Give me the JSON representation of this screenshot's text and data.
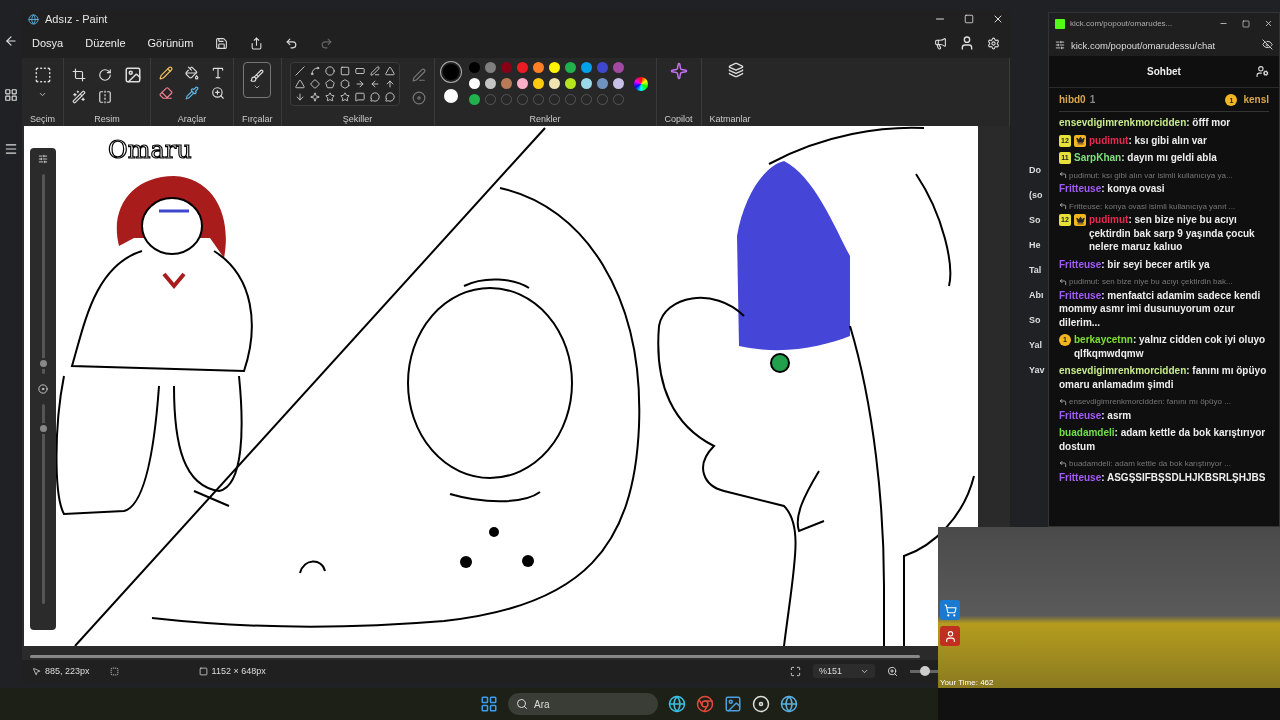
{
  "paint": {
    "title": "Adsız - Paint",
    "menu": [
      "Dosya",
      "Düzenle",
      "Görünüm"
    ],
    "groups": [
      "Seçim",
      "Resim",
      "Araçlar",
      "Fırçalar",
      "Şekiller",
      "Renkler",
      "Copilot",
      "Katmanlar"
    ],
    "current_colors": [
      {
        "color": "#000000"
      },
      {
        "color": "#ffffff"
      }
    ],
    "colors": [
      {
        "color": "#000000"
      },
      {
        "color": "#7f7f7f"
      },
      {
        "color": "#880015"
      },
      {
        "color": "#ed1c24"
      },
      {
        "color": "#ff7f27"
      },
      {
        "color": "#fff200"
      },
      {
        "color": "#22b14c"
      },
      {
        "color": "#00a2e8"
      },
      {
        "color": "#3f48cc"
      },
      {
        "color": "#a349a4"
      },
      {
        "color": "#ffffff"
      },
      {
        "color": "#c3c3c3"
      },
      {
        "color": "#b97a57"
      },
      {
        "color": "#ffaec9"
      },
      {
        "color": "#ffc90e"
      },
      {
        "color": "#efe4b0"
      },
      {
        "color": "#b5e61d"
      },
      {
        "color": "#99d9ea"
      },
      {
        "color": "#7092be"
      },
      {
        "color": "#c8bfe7"
      },
      {
        "color": "#22b14c"
      }
    ],
    "canvas_caption": "Omaru",
    "brush_size": {
      "level": 0.03
    },
    "opacity": {
      "level": 0.9
    },
    "status": {
      "cursor": "885, 223px",
      "size": "1152 × 648px",
      "zoom": "%151",
      "zoom_slider": {
        "level": 0.4
      }
    }
  },
  "background_page": [
    "Do",
    "(so",
    "So",
    "He",
    "Tal",
    "Abı",
    "So",
    "Yal",
    "Yav"
  ],
  "chat": {
    "tab_title": "kick.com/popout/omarudes...",
    "url": "kick.com/popout/omarudessu/chat",
    "header": "Sohbet",
    "pinned": {
      "user": "hibd0",
      "count": "1",
      "badge": "1",
      "other": "kensl"
    },
    "messages": [
      {
        "user": "ensevdigimrenkmorcidden",
        "color": "#c8ec8c",
        "text": ": öfff mor"
      },
      {
        "badges": [
          {
            "kind": "sub",
            "label": "12"
          },
          {
            "kind": "crown"
          }
        ],
        "user": "pudimut",
        "color": "#e5294f",
        "text": ": ksı gibi alın var"
      },
      {
        "badges": [
          {
            "kind": "sub",
            "label": "11"
          }
        ],
        "user": "SarpKhan",
        "color": "#7ee07a",
        "text": ": dayın mı geldi abla"
      },
      {
        "reply": "pudimut: ksı gibi alın var isimli kullanıcıya ya...",
        "user": "Fritteuse",
        "color": "#a05cf5",
        "text": ": konya ovasi"
      },
      {
        "reply": "Fritteuse: konya ovasi isimli kullanıcıya yanıt ...",
        "badges": [
          {
            "kind": "sub",
            "label": "12"
          },
          {
            "kind": "crown"
          }
        ],
        "user": "pudimut",
        "color": "#e5294f",
        "text": ": sen bize niye bu acıyı çektirdin bak sarp 9 yaşında çocuk nelere maruz kalıuo"
      },
      {
        "user": "Fritteuse",
        "color": "#a05cf5",
        "text": ": bir seyi becer artik ya"
      },
      {
        "reply": "pudimut: sen bize niye bu acıyı çektirdin bak...",
        "user": "Fritteuse",
        "color": "#a05cf5",
        "text": ": menfaatci adamim sadece kendi mommy asmr imi dusunuyorum ozur dilerim..."
      },
      {
        "badges": [
          {
            "kind": "gift",
            "label": "1"
          }
        ],
        "user": "berkaycetnn",
        "color": "#7fe02e",
        "text": ": yalnız cidden cok iyi oluyo qlfkqmwdqmw"
      },
      {
        "user": "ensevdigimrenkmorcidden",
        "color": "#c8ec8c",
        "text": ": fanını mı öpüyo omaru anlamadım şimdi"
      },
      {
        "reply": "ensevdigimrenkmorcidden: fanını mı öpüyo ...",
        "user": "Fritteuse",
        "color": "#a05cf5",
        "text": ": asrm"
      },
      {
        "user": "buadamdeli",
        "color": "#6fe046",
        "text": ": adam kettle da bok karıştırıyor dostum"
      },
      {
        "reply": "buadamdeli: adam kettle da bok karıştınyor ...",
        "user": "Fritteuse",
        "color": "#a05cf5",
        "text": ": ASGŞSIFBŞSDLHJKBSRLŞHJBS"
      }
    ]
  },
  "game": {
    "timer": "Your Time: 462"
  },
  "taskbar": {
    "search": "Ara"
  }
}
